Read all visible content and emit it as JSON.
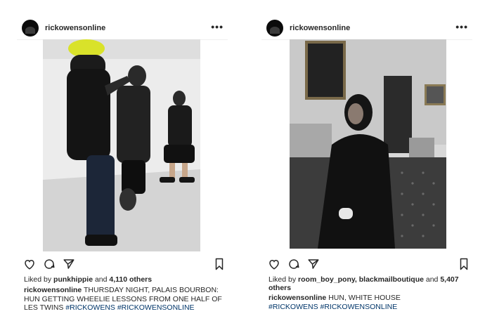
{
  "posts": [
    {
      "username": "rickowensonline",
      "more_icon": "more-horizontal-icon",
      "likes_prefix": "Liked by",
      "likes_user": "punkhippie",
      "likes_connector": "and",
      "likes_others": "4,110 others",
      "caption_user": "rickowensonline",
      "caption_text": "THURSDAY NIGHT, PALAIS BOURBON: HUN GETTING WHEELIE LESSONS FROM ONE HALF OF LES TWINS",
      "hashtags": "#RICKOWENS #RICKOWENSONLINE"
    },
    {
      "username": "rickowensonline",
      "more_icon": "more-horizontal-icon",
      "likes_prefix": "Liked by",
      "likes_user": "room_boy_pony, blackmailboutique",
      "likes_connector": "and",
      "likes_others": "5,407 others",
      "caption_user": "rickowensonline",
      "caption_text": "HUN, WHITE HOUSE",
      "hashtags": "#RICKOWENS #RICKOWENSONLINE"
    }
  ],
  "colors": {
    "text": "#262626",
    "hashtag": "#003569",
    "divider": "#efefef"
  }
}
